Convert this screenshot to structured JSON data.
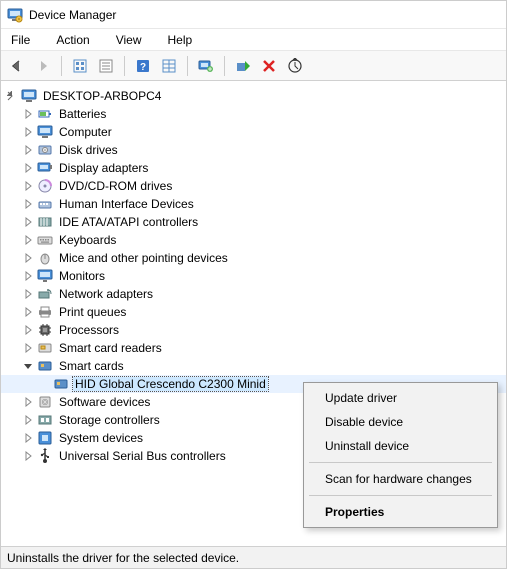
{
  "window": {
    "title": "Device Manager"
  },
  "menu": {
    "file": "File",
    "action": "Action",
    "view": "View",
    "help": "Help"
  },
  "toolbar_icons": {
    "back": "back-icon",
    "forward": "forward-icon",
    "show_hidden": "show-hidden-icon",
    "properties": "properties-icon",
    "help": "help-icon",
    "view_type": "view-type-icon",
    "monitor": "update-driver-icon",
    "enable": "enable-device-icon",
    "uninstall": "uninstall-icon",
    "scan": "scan-hardware-icon"
  },
  "root": {
    "name": "DESKTOP-ARBOPC4"
  },
  "categories": [
    {
      "label": "Batteries",
      "icon": "battery-icon",
      "expanded": false
    },
    {
      "label": "Computer",
      "icon": "computer-icon",
      "expanded": false
    },
    {
      "label": "Disk drives",
      "icon": "disk-icon",
      "expanded": false
    },
    {
      "label": "Display adapters",
      "icon": "display-adapter-icon",
      "expanded": false
    },
    {
      "label": "DVD/CD-ROM drives",
      "icon": "optical-drive-icon",
      "expanded": false
    },
    {
      "label": "Human Interface Devices",
      "icon": "hid-icon",
      "expanded": false
    },
    {
      "label": "IDE ATA/ATAPI controllers",
      "icon": "ide-icon",
      "expanded": false
    },
    {
      "label": "Keyboards",
      "icon": "keyboard-icon",
      "expanded": false
    },
    {
      "label": "Mice and other pointing devices",
      "icon": "mouse-icon",
      "expanded": false
    },
    {
      "label": "Monitors",
      "icon": "monitor-icon",
      "expanded": false
    },
    {
      "label": "Network adapters",
      "icon": "network-adapter-icon",
      "expanded": false
    },
    {
      "label": "Print queues",
      "icon": "printer-icon",
      "expanded": false
    },
    {
      "label": "Processors",
      "icon": "processor-icon",
      "expanded": false
    },
    {
      "label": "Smart card readers",
      "icon": "smartcard-reader-icon",
      "expanded": false
    },
    {
      "label": "Smart cards",
      "icon": "smartcard-icon",
      "expanded": true,
      "children": [
        {
          "label": "HID Global Crescendo C2300 Minid",
          "icon": "smartcard-device-icon",
          "selected": true
        }
      ]
    },
    {
      "label": "Software devices",
      "icon": "software-device-icon",
      "expanded": false
    },
    {
      "label": "Storage controllers",
      "icon": "storage-controller-icon",
      "expanded": false
    },
    {
      "label": "System devices",
      "icon": "system-device-icon",
      "expanded": false
    },
    {
      "label": "Universal Serial Bus controllers",
      "icon": "usb-icon",
      "expanded": false
    }
  ],
  "context_menu": {
    "update": "Update driver",
    "disable": "Disable device",
    "uninstall": "Uninstall device",
    "scan": "Scan for hardware changes",
    "properties": "Properties"
  },
  "statusbar": {
    "text": "Uninstalls the driver for the selected device."
  }
}
